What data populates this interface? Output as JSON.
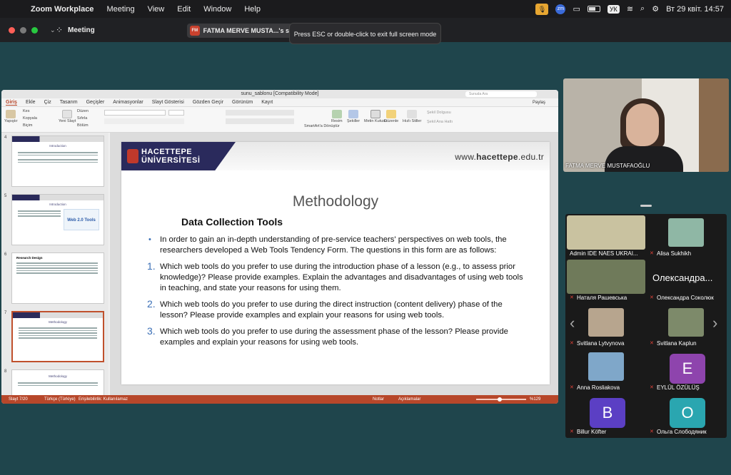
{
  "menubar": {
    "app": "Zoom Workplace",
    "items": [
      "Meeting",
      "View",
      "Edit",
      "Window",
      "Help"
    ],
    "lang": "УК",
    "clock": "Вт 29 квіт.  14:57"
  },
  "zoom_bar": {
    "title": "Meeting",
    "share_initials": "FM",
    "share_label": "FATMA MERVE MUSTA...'s sc",
    "esc_hint": "Press ESC or double-click to exit full screen mode"
  },
  "ppt": {
    "window_title": "sunu_sablonu [Compatibility Mode]",
    "search_placeholder": "Sunuda Ara",
    "tabs": [
      "Giriş",
      "Ekle",
      "Çiz",
      "Tasarım",
      "Geçişler",
      "Animasyonlar",
      "Slayt Gösterisi",
      "Gözden Geçir",
      "Görünüm",
      "Kayıt"
    ],
    "share": "Paylaş",
    "ribbon": {
      "paste": "Yapıştır",
      "cut": "Kes",
      "copy": "Kopyala",
      "format": "Biçim",
      "new_slide": "Yeni Slayt",
      "layout": "Düzen",
      "reset": "Sıfırla",
      "section": "Bölüm",
      "smartart": "SmartArt'a Dönüştür",
      "picture": "Resim",
      "shapes": "Şekiller",
      "textbox": "Metin Kutusu",
      "arrange": "Düzenle",
      "quick_styles": "Hızlı Stiller",
      "shape_fill": "Şekil Dolgusu",
      "shape_outline": "Şekil Ana Hattı"
    },
    "thumbnails": [
      {
        "num": "4",
        "title": "Introduction"
      },
      {
        "num": "5",
        "title": "Introduction",
        "badge": "Web 2.0 Tools"
      },
      {
        "num": "6",
        "title": "Research Design"
      },
      {
        "num": "7",
        "title": "Methodology"
      },
      {
        "num": "8",
        "title": "Methodology"
      }
    ],
    "status": {
      "slide": "Slayt 7/20",
      "lang": "Türkçe (Türkiye)",
      "access": "Erişilebilirlik: Kullanılamaz",
      "notes": "Notlar",
      "comments": "Açıklamalar",
      "zoom": "%129"
    }
  },
  "slide": {
    "logo_line1": "HACETTEPE",
    "logo_line2": "ÜNİVERSİTESİ",
    "url_prefix": "www.",
    "url_bold": "hacettepe",
    "url_suffix": ".edu.tr",
    "title": "Methodology",
    "subtitle": "Data Collection Tools",
    "intro": "In order to gain an in-depth understanding of pre-service teachers' perspectives on web tools, the researchers developed a Web Tools Tendency Form. The questions in this form are as follows:",
    "questions": [
      {
        "n": "1.",
        "text": "Which web tools do you prefer to use during the introduction phase of a lesson (e.g., to assess prior knowledge)? Please provide examples. Explain the advantages and disadvantages of using web tools in teaching, and state your reasons for using them."
      },
      {
        "n": "2.",
        "text": "Which web tools do you prefer to use during the direct instruction (content delivery) phase of the lesson? Please provide examples and explain your reasons for using web tools."
      },
      {
        "n": "3.",
        "text": "Which web tools do you prefer to use during the assessment phase of the lesson? Please provide examples and explain your reasons for using web tools."
      }
    ]
  },
  "speaker": {
    "name": "FATMA MERVE MUSTAFAOĞLU"
  },
  "participants": [
    {
      "name": "Admin IDE NAES UKRAI...",
      "type": "video",
      "color": "#c9c2a0"
    },
    {
      "name": "Alisa Sukhikh",
      "type": "video",
      "color": "#8fb7a5"
    },
    {
      "name": "Наталя Рашевська",
      "type": "video",
      "color": "#6f7a5a",
      "muted": true
    },
    {
      "name": "Олександра Соколюк",
      "type": "text",
      "big": "Олександра...",
      "muted": true
    },
    {
      "name": "Svitlana Lytvynova",
      "type": "video",
      "color": "#b7a58e",
      "muted": true
    },
    {
      "name": "Svitlana Kaplun",
      "type": "video",
      "color": "#7d8a6a",
      "muted": true
    },
    {
      "name": "Anna Rosliakova",
      "type": "video",
      "color": "#7fa7c9",
      "muted": true
    },
    {
      "name": "EYLÜL ÖZÜLÜŞ",
      "type": "avatar",
      "letter": "E",
      "color": "#8e44ad",
      "muted": true
    },
    {
      "name": "Billur Köfter",
      "type": "avatar",
      "letter": "B",
      "color": "#5b3fc4",
      "muted": true
    },
    {
      "name": "Ольга Слободяник",
      "type": "avatar",
      "letter": "O",
      "color": "#2aa6b0",
      "muted": true
    }
  ],
  "nav": {
    "prev": "‹",
    "next": "›"
  }
}
